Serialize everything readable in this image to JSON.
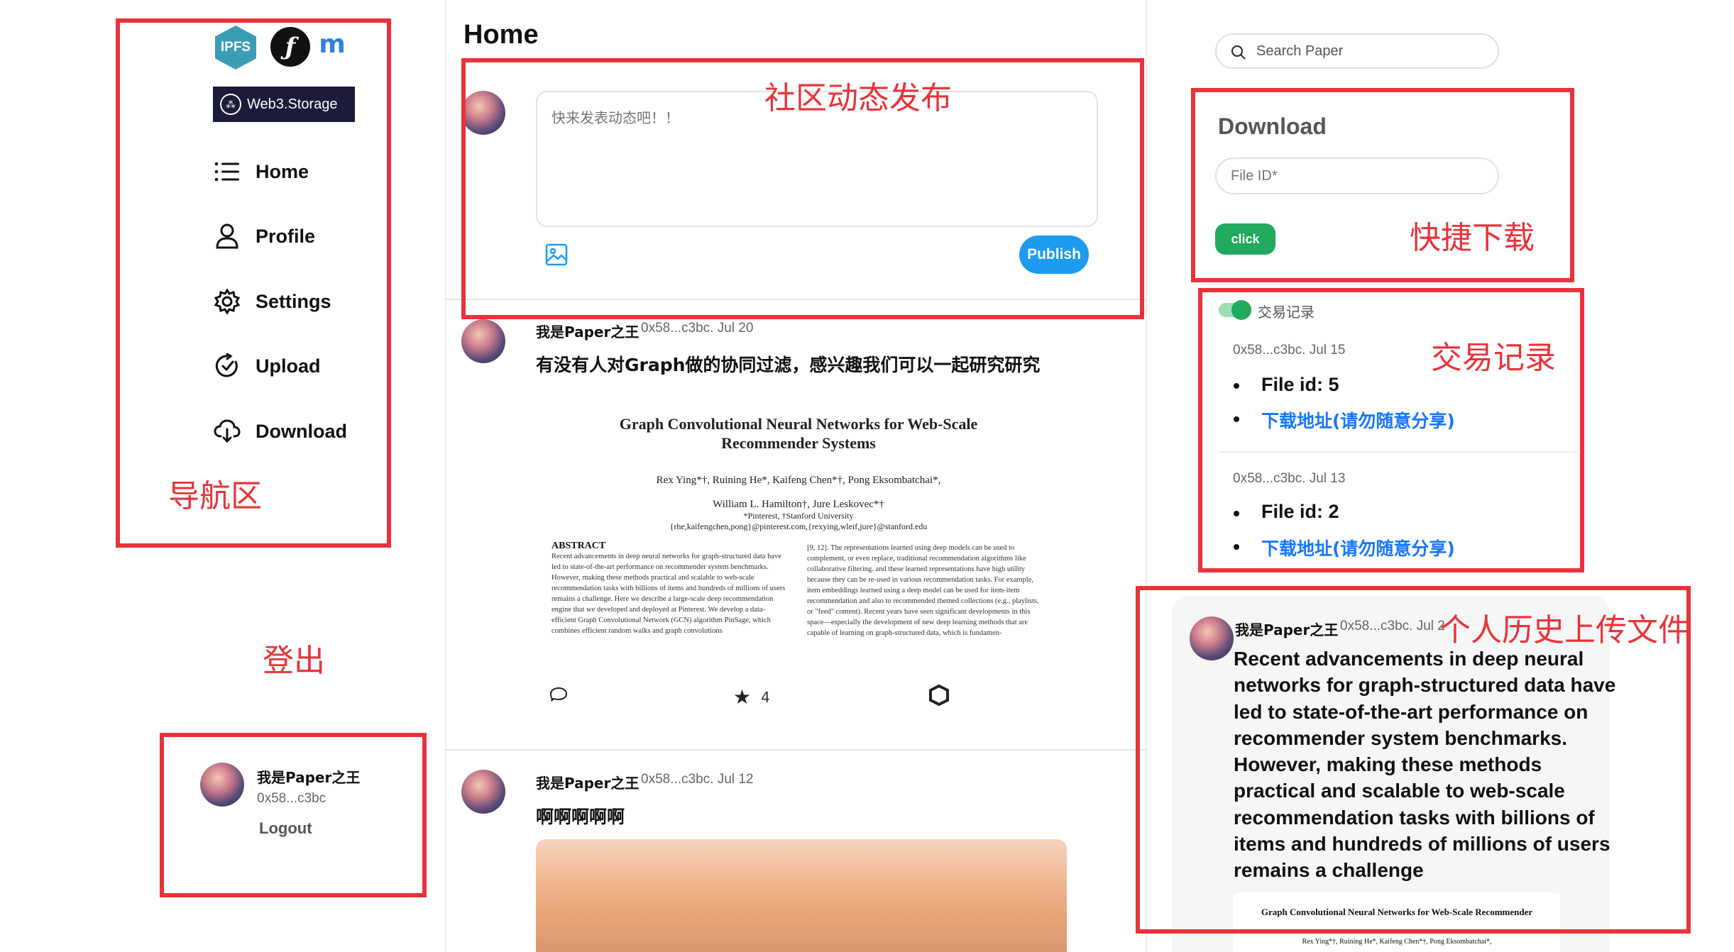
{
  "sidebar": {
    "logos": {
      "ipfs": "IPFS",
      "filecoin": "ƒ",
      "metamask": "m"
    },
    "web3_storage_badge": "Web3.Storage",
    "nav": [
      {
        "label": "Home",
        "icon": "list-icon"
      },
      {
        "label": "Profile",
        "icon": "user-icon"
      },
      {
        "label": "Settings",
        "icon": "gear-icon"
      },
      {
        "label": "Upload",
        "icon": "upload-check-icon"
      },
      {
        "label": "Download",
        "icon": "cloud-download-icon"
      }
    ],
    "user": {
      "name": "我是Paper之王",
      "address": "0x58...c3bc",
      "logout_label": "Logout"
    }
  },
  "main": {
    "title": "Home",
    "composer": {
      "placeholder": "快来发表动态吧！！",
      "publish_label": "Publish"
    },
    "posts": [
      {
        "author": "我是Paper之王",
        "meta": "0x58...c3bc. Jul 20",
        "text": "有没有人对Graph做的协同过滤，感兴趣我们可以一起研究研究",
        "paper": {
          "title_line1": "Graph Convolutional Neural Networks for Web-Scale",
          "title_line2": "Recommender Systems",
          "authors_line1": "Rex Ying*†, Ruining He*, Kaifeng Chen*†, Pong Eksombatchai*,",
          "authors_line2": "William L. Hamilton†, Jure Leskovec*†",
          "affiliations": "*Pinterest, †Stanford University",
          "emails": "{rhe,kaifengchen,pong}@pinterest.com,{rexying,wleif,jure}@stanford.edu",
          "abstract_heading": "ABSTRACT",
          "abstract_text": "Recent advancements in deep neural networks for graph-structured data have led to state-of-the-art performance on recommender system benchmarks. However, making these methods practical and scalable to web-scale recommendation tasks with billions of items and hundreds of millions of users remains a challenge. Here we describe a large-scale deep recommendation engine that we developed and deployed at Pinterest. We develop a data-efficient Graph Convolutional Network (GCN) algorithm PinSage, which combines efficient random walks and graph convolutions",
          "right_col_text": "[9, 12]. The representations learned using deep models can be used to complement, or even replace, traditional recommendation algorithms like collaborative filtering. and these learned representations have high utility because they can be re-used in various recommendation tasks. For example, item embeddings learned using a deep model can be used for item-item recommendation and also to recommended themed collections (e.g., playlists, or \"feed\" content). Recent years have seen significant developments in this space—especially the development of new deep learning methods that are capable of learning on graph-structured data, which is fundamen-"
        },
        "star_count": "4"
      },
      {
        "author": "我是Paper之王",
        "meta": "0x58...c3bc. Jul 12",
        "text": "啊啊啊啊啊"
      }
    ]
  },
  "right": {
    "search_placeholder": "Search Paper",
    "download": {
      "title": "Download",
      "field_placeholder": "File ID*",
      "button_label": "click"
    },
    "transactions": {
      "label": "交易记录",
      "items": [
        {
          "meta": "0x58...c3bc. Jul 15",
          "file": "File id: 5",
          "link": "下载地址(请勿随意分享)"
        },
        {
          "meta": "0x58...c3bc. Jul 13",
          "file": "File id: 2",
          "link": "下载地址(请勿随意分享)"
        }
      ]
    },
    "history": {
      "author": "我是Paper之王",
      "meta": "0x58...c3bc. Jul 2",
      "text": "Recent advancements in deep neural networks for graph-structured data have led to state-of-the-art performance on recommender system benchmarks. However, making these methods practical and scalable to web-scale recommendation tasks with billions of items and hundreds of millions of users remains a challenge",
      "paper_title": "Graph Convolutional Neural Networks for Web-Scale Recommender Systems",
      "paper_authors": "Rex Ying*†, Ruining He*, Kaifeng Chen*†, Pong Eksombatchai*,"
    }
  },
  "annotations": {
    "nav_area": "导航区",
    "logout_area": "登出",
    "post_area": "社区动态发布",
    "quick_download": "快捷下载",
    "tx_records": "交易记录",
    "history_uploads": "个人历史上传文件"
  },
  "colors": {
    "annotation_red": "#e8333a",
    "publish_blue": "#1d9bf0",
    "click_green": "#21a95d",
    "link_blue": "#1677ff"
  }
}
